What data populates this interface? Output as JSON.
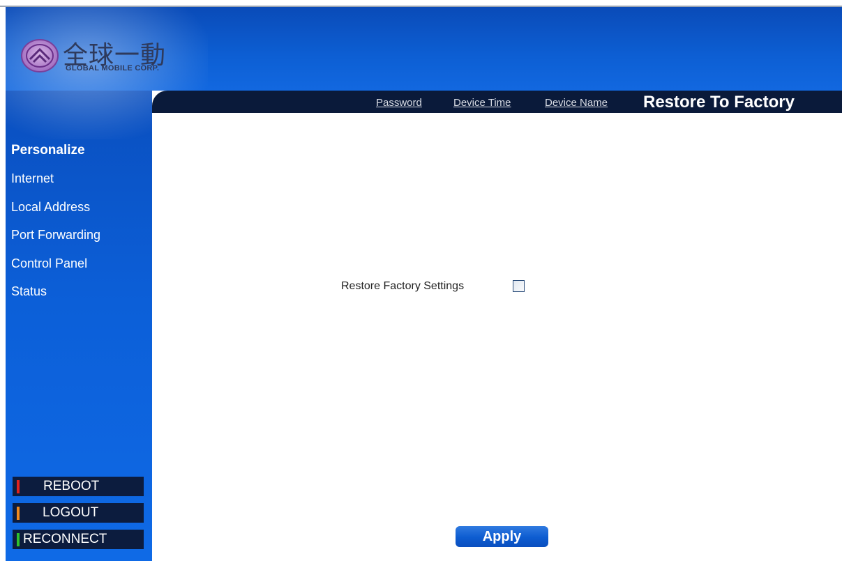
{
  "brand": {
    "name_cn": "全球一動",
    "name_en": "GLOBAL MOBILE CORP."
  },
  "tabs": {
    "links": [
      {
        "label": "Password"
      },
      {
        "label": "Device Time"
      },
      {
        "label": "Device Name"
      }
    ],
    "active_label": "Restore To Factory"
  },
  "sidebar": {
    "items": [
      {
        "label": "Personalize",
        "active": true
      },
      {
        "label": "Internet"
      },
      {
        "label": "Local Address"
      },
      {
        "label": "Port Forwarding"
      },
      {
        "label": "Control Panel"
      },
      {
        "label": "Status"
      }
    ],
    "buttons": [
      {
        "label": "REBOOT",
        "color": "#e0221e"
      },
      {
        "label": "LOGOUT",
        "color": "#f08a1c"
      },
      {
        "label": "RECONNECT",
        "color": "#2ec22e"
      }
    ]
  },
  "main": {
    "restore_label": "Restore Factory Settings",
    "restore_checked": false,
    "apply_label": "Apply"
  },
  "colors": {
    "header_blue": "#0c5fd4",
    "tabbar_navy": "#0a1a3a",
    "button_navy": "#0c1c3e"
  },
  "icons": {
    "logo": "global-mobile-logo-icon"
  }
}
